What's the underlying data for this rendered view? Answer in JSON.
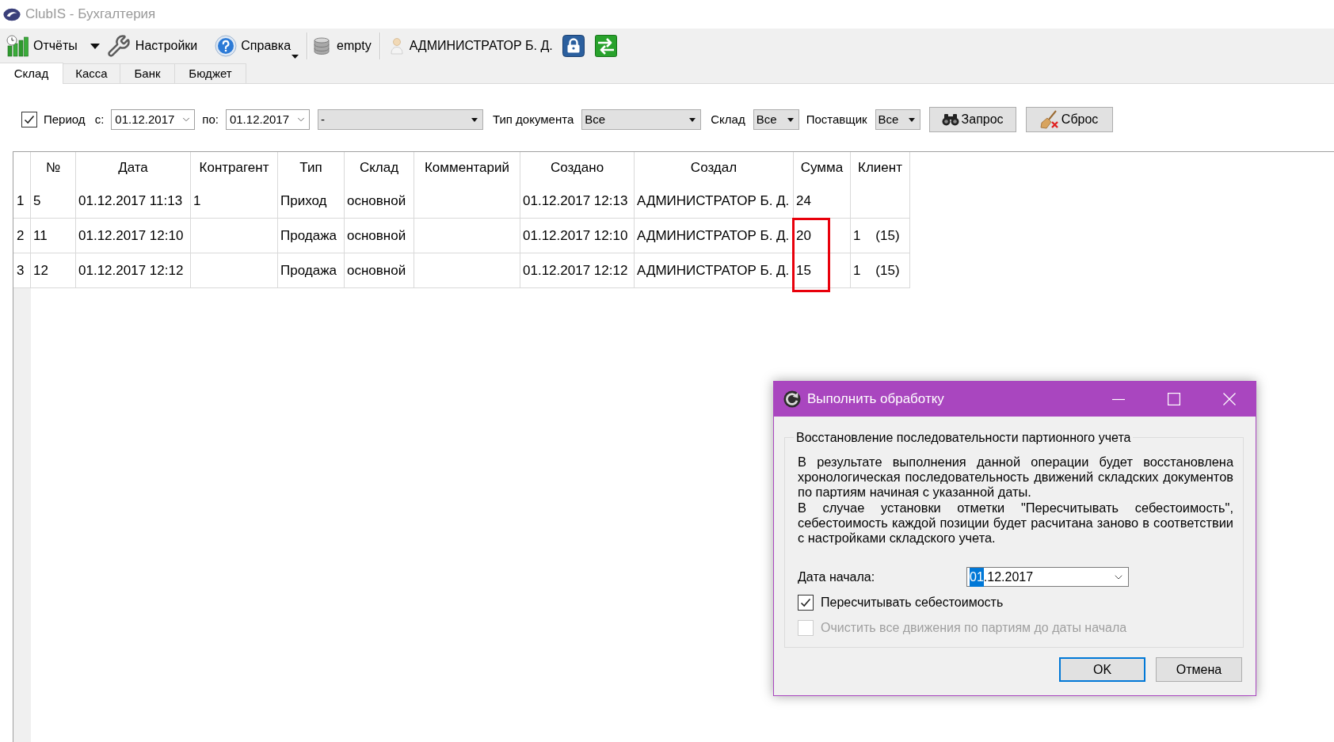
{
  "window": {
    "title": "ClubIS - Бухгалтерия"
  },
  "toolbar": {
    "reports": {
      "label": "Отчёты"
    },
    "settings": {
      "label": "Настройки"
    },
    "help": {
      "label": "Справка"
    },
    "database": {
      "label": "empty"
    },
    "user": {
      "label": "АДМИНИСТРАТОР Б. Д."
    }
  },
  "tabs": [
    {
      "label": "Склад",
      "selected": true
    },
    {
      "label": "Касса",
      "selected": false
    },
    {
      "label": "Банк",
      "selected": false
    },
    {
      "label": "Бюджет",
      "selected": false
    }
  ],
  "filters": {
    "period": {
      "label": "Период",
      "checked": true
    },
    "date_from": {
      "label": "с:",
      "value": "01.12.2017"
    },
    "date_to": {
      "label": "по:",
      "value": "01.12.2017"
    },
    "preset": {
      "value": "-"
    },
    "doc_type": {
      "label": "Тип документа",
      "value": "Все"
    },
    "warehouse": {
      "label": "Склад",
      "value": "Все"
    },
    "supplier": {
      "label": "Поставщик",
      "value": "Все"
    },
    "query_button": "Запрос",
    "reset_button": "Сброс"
  },
  "table": {
    "columns": [
      "№",
      "Дата",
      "Контрагент",
      "Тип",
      "Склад",
      "Комментарий",
      "Создано",
      "Создал",
      "Сумма",
      "Клиент"
    ],
    "rows": [
      {
        "row_number": "1",
        "no": "5",
        "date": "01.12.2017 11:13",
        "counterparty": "1",
        "type": "Приход",
        "warehouse": "основной",
        "created": "01.12.2017 12:13",
        "created_by": "АДМИНИСТРАТОР Б. Д.",
        "sum": "24",
        "sum_marked": false
      },
      {
        "row_number": "2",
        "no": "11",
        "date": "01.12.2017 12:10",
        "type": "Продажа",
        "warehouse": "основной",
        "created": "01.12.2017 12:10",
        "created_by": "АДМИНИСТРАТОР Б. Д.",
        "sum": "20",
        "client": "1    (15)",
        "sum_marked": true
      },
      {
        "row_number": "3",
        "no": "12",
        "date": "01.12.2017 12:12",
        "type": "Продажа",
        "warehouse": "основной",
        "created": "01.12.2017 12:12",
        "created_by": "АДМИНИСТРАТОР Б. Д.",
        "sum": "15",
        "client": "1    (15)",
        "sum_marked": true
      }
    ]
  },
  "dialog": {
    "title": "Выполнить обработку",
    "group_title": "Восстановление последовательности партионного учета",
    "description": [
      "В результате выполнения данной операции будет восстановлена хронологическая последовательность движений складских документов по партиям начиная с указанной даты.",
      "В случае установки отметки \"Пересчитывать себестоимость\", себестоимость каждой позиции будет расчитана заново в соответствии с настройками складского учета."
    ],
    "start_date": {
      "label": "Дата начала:",
      "value_parts": [
        {
          "text": "01",
          "selected": true
        },
        {
          "text": ".12.2017",
          "selected": false
        }
      ]
    },
    "options": [
      {
        "label": "Пересчитывать себестоимость",
        "checked": true,
        "disabled": false
      },
      {
        "label": "Очистить все движения по партиям до даты начала",
        "checked": false,
        "disabled": true
      }
    ],
    "buttons": [
      {
        "label": "OK",
        "focused": true
      },
      {
        "label": "Отмена",
        "focused": false
      }
    ]
  }
}
